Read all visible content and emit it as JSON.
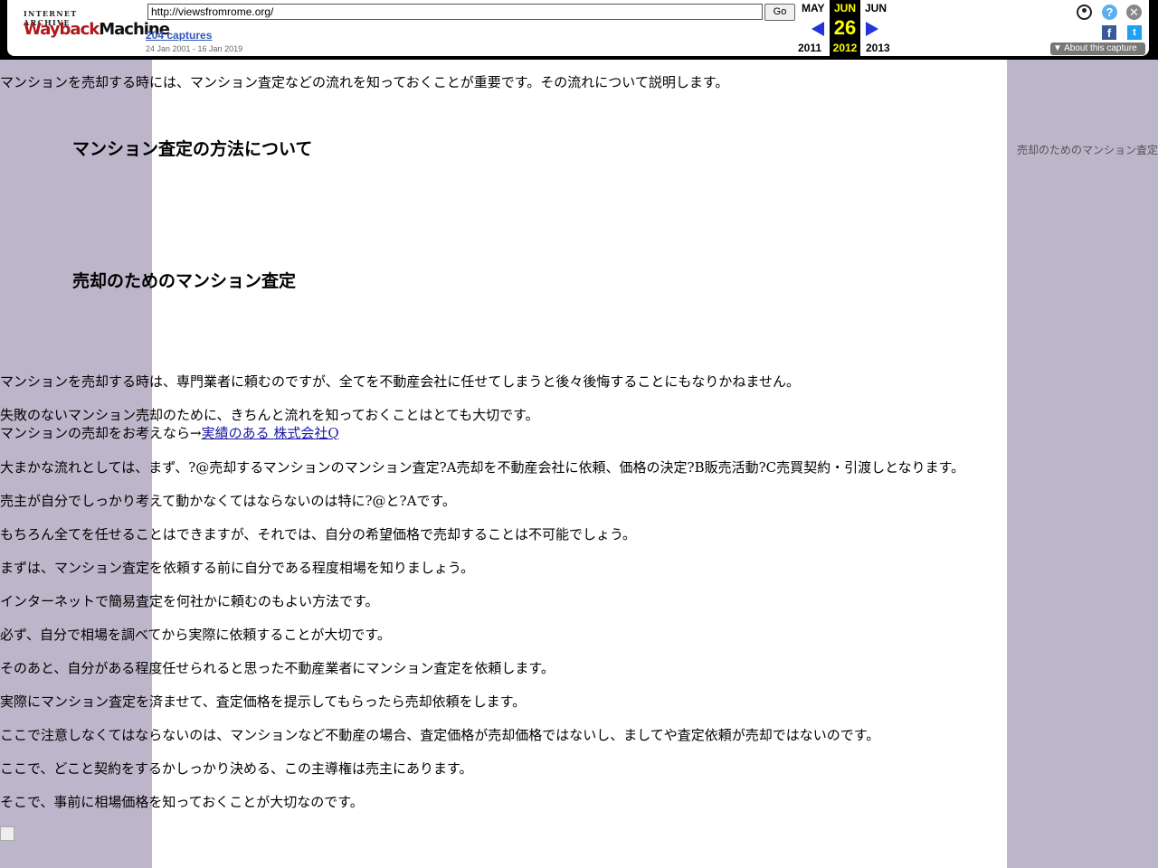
{
  "toolbar": {
    "logo_top": "INTERNET ARCHIVE",
    "logo_word1": "Wayback",
    "logo_word2": "Machine",
    "url": "http://viewsfromrome.org/",
    "go_label": "Go",
    "captures": "204 captures",
    "range": "24 Jan 2001 - 16 Jan 2019",
    "prev_month": "MAY",
    "cur_month": "JUN",
    "next_month": "JUN",
    "cur_day": "26",
    "prev_year": "2011",
    "cur_year": "2012",
    "next_year": "2013",
    "help_glyph": "?",
    "close_glyph": "✕",
    "fb_glyph": "f",
    "tw_glyph": "t",
    "about": "▼ About this capture"
  },
  "page": {
    "intro": "マンションを売却する時には、マンション査定などの流れを知っておくことが重要です。その流れについて説明します。",
    "heading1": "マンション査定の方法について",
    "heading2": "売却のためのマンション査定",
    "side_link": "売却のためのマンション査定",
    "para1": "マンションを売却する時は、専門業者に頼むのですが、全てを不動産会社に任せてしまうと後々後悔することにもなりかねません。",
    "para2a": "失敗のないマンション売却のために、きちんと流れを知っておくことはとても大切です。",
    "para2b": "マンションの売却をお考えなら→",
    "para2_link": "実績のある 株式会社Q",
    "para3": "大まかな流れとしては、まず、?@売却するマンションのマンション査定?A売却を不動産会社に依頼、価格の決定?B販売活動?C売買契約・引渡しとなります。",
    "para4": "売主が自分でしっかり考えて動かなくてはならないのは特に?@と?Aです。",
    "para5": "もちろん全てを任せることはできますが、それでは、自分の希望価格で売却することは不可能でしょう。",
    "para6": "まずは、マンション査定を依頼する前に自分である程度相場を知りましょう。",
    "para7": "インターネットで簡易査定を何社かに頼むのもよい方法です。",
    "para8": "必ず、自分で相場を調べてから実際に依頼することが大切です。",
    "para9": "そのあと、自分がある程度任せられると思った不動産業者にマンション査定を依頼します。",
    "para10": "実際にマンション査定を済ませて、査定価格を提示してもらったら売却依頼をします。",
    "para11": "ここで注意しなくてはならないのは、マンションなど不動産の場合、査定価格が売却価格ではないし、ましてや査定依頼が売却ではないのです。",
    "para12": "ここで、どこと契約をするかしっかり決める、この主導権は売主にあります。",
    "para13": "そこで、事前に相場価格を知っておくことが大切なのです。"
  }
}
